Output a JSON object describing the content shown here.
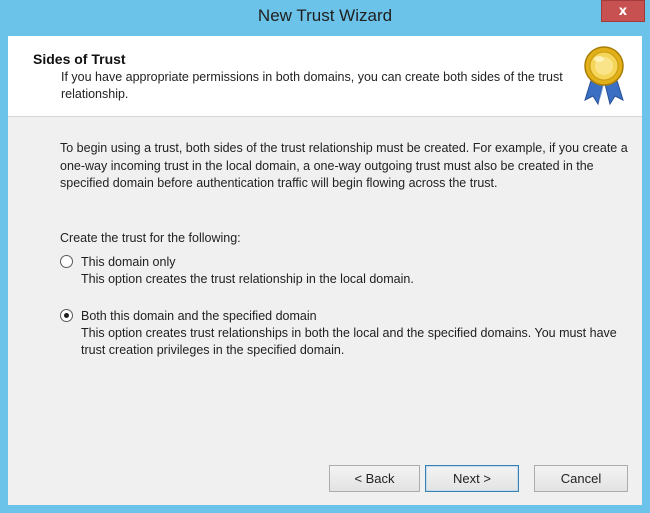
{
  "window": {
    "title": "New Trust Wizard",
    "close_label": "x"
  },
  "header": {
    "title": "Sides of Trust",
    "subtitle": "If you have appropriate permissions in both domains, you can create both sides of the trust relationship.",
    "icon": "award-ribbon-icon"
  },
  "body": {
    "intro": "To begin using a trust, both sides of the trust relationship must be created. For example, if you create a one-way incoming trust in the local domain, a one-way outgoing trust must also be created in the specified domain before authentication traffic will begin flowing across the trust.",
    "create_label": "Create the trust for the following:",
    "options": [
      {
        "label": "This domain only",
        "description": "This option creates the trust relationship in the local domain.",
        "selected": false
      },
      {
        "label": "Both this domain and the specified domain",
        "description": "This option creates trust relationships in both the local and the specified domains. You must have trust creation privileges in the specified domain.",
        "selected": true
      }
    ]
  },
  "buttons": {
    "back": "< Back",
    "next": "Next >",
    "cancel": "Cancel"
  }
}
